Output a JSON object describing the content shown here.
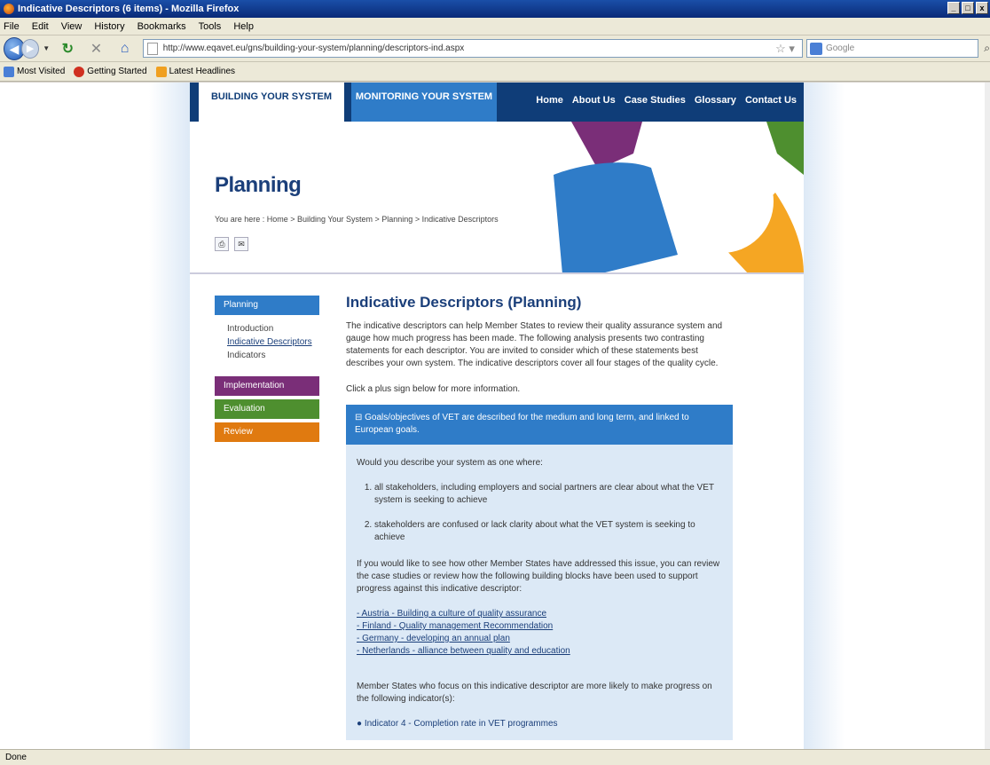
{
  "window": {
    "title": "Indicative Descriptors (6 items) - Mozilla Firefox",
    "buttons": [
      "_",
      "□",
      "x"
    ]
  },
  "menu": [
    "File",
    "Edit",
    "View",
    "History",
    "Bookmarks",
    "Tools",
    "Help"
  ],
  "navbar": {
    "url": "http://www.eqavet.eu/gns/building-your-system/planning/descriptors-ind.aspx",
    "search_placeholder": "Google"
  },
  "bookmarks": [
    {
      "label": "Most Visited",
      "color": "#4a7fd6"
    },
    {
      "label": "Getting Started",
      "color": "#d03020"
    },
    {
      "label": "Latest Headlines",
      "color": "#f0a020"
    }
  ],
  "site": {
    "tabs": {
      "build": "BUILDING YOUR SYSTEM",
      "monitor": "MONITORING YOUR SYSTEM"
    },
    "toplinks": [
      "Home",
      "About Us",
      "Case Studies",
      "Glossary",
      "Contact Us"
    ],
    "banner_title": "Planning",
    "breadcrumb": "You are here : Home > Building Your System > Planning > Indicative Descriptors",
    "banner_btns": [
      "⎙",
      "✉"
    ]
  },
  "leftnav": {
    "planning": "Planning",
    "sub": [
      "Introduction",
      "Indicative Descriptors",
      "Indicators"
    ],
    "implementation": "Implementation",
    "evaluation": "Evaluation",
    "review": "Review"
  },
  "main": {
    "heading": "Indicative Descriptors (Planning)",
    "intro": "The indicative descriptors can help Member States to review their quality assurance system and gauge how much progress has been made. The following analysis presents two contrasting statements for each descriptor. You are invited to consider which of these statements best describes your own system. The indicative descriptors cover all four stages of the quality cycle.",
    "click_hint": "Click a plus sign below for more information.",
    "accordion_head": "⊟  Goals/objectives of VET are described for the medium and long term, and linked to European goals.",
    "question": "Would you describe your system as one where:",
    "options": [
      "all stakeholders, including employers and social partners are clear about what the VET system is seeking to achieve",
      "stakeholders are confused or lack clarity about what the VET system is seeking to achieve"
    ],
    "review_text": "If you would like to see how other Member States have addressed this issue, you can review the case studies or review how the following building blocks have been used to support progress against this indicative descriptor:",
    "links": [
      "- Austria - Building a culture of quality assurance",
      "- Finland - Quality management Recommendation",
      "- Germany - developing an annual plan",
      "- Netherlands - alliance between quality and education"
    ],
    "indicators_text": "Member States who focus on this indicative descriptor are more likely to make progress on the following indicator(s):",
    "indicator": "●  Indicator 4 - Completion rate in VET programmes"
  },
  "status": "Done"
}
